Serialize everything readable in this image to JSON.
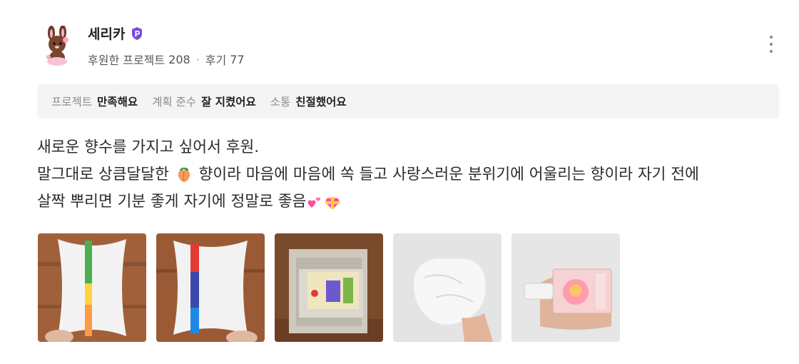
{
  "author": {
    "nickname": "세리카",
    "backed_label": "후원한 프로젝트",
    "backed_count": "208",
    "separator": "·",
    "reviews_label": "후기",
    "reviews_count": "77",
    "badge_icon": "verified-badge-icon",
    "badge_color": "#7b4ae2"
  },
  "ratings": [
    {
      "label": "프로젝트",
      "value": "만족해요"
    },
    {
      "label": "계획 준수",
      "value": "잘 지켰어요"
    },
    {
      "label": "소통",
      "value": "친절했어요"
    }
  ],
  "review": {
    "line1": "새로운 향수를 가지고 싶어서 후원.",
    "line2_a": "말그대로 상큼달달한",
    "line2_b": "향이라 마음에 마음에 쏙 들고 사랑스러운 분위기에 어울리는 향이라 자기 전에",
    "line3": "살짝 뿌리면 기분 좋게 자기에 정말로 좋음",
    "emojis": [
      "peach-emoji",
      "two-hearts-emoji",
      "heart-with-ribbon-emoji"
    ]
  },
  "photos": [
    "photo-pillow-box-front",
    "photo-pillow-box-back",
    "photo-open-box",
    "photo-wrapping-paper",
    "photo-perfume-bottle"
  ],
  "colors": {
    "rating_bg": "#f4f4f4",
    "text": "#2c2c2c",
    "muted": "#8a8a8a"
  }
}
